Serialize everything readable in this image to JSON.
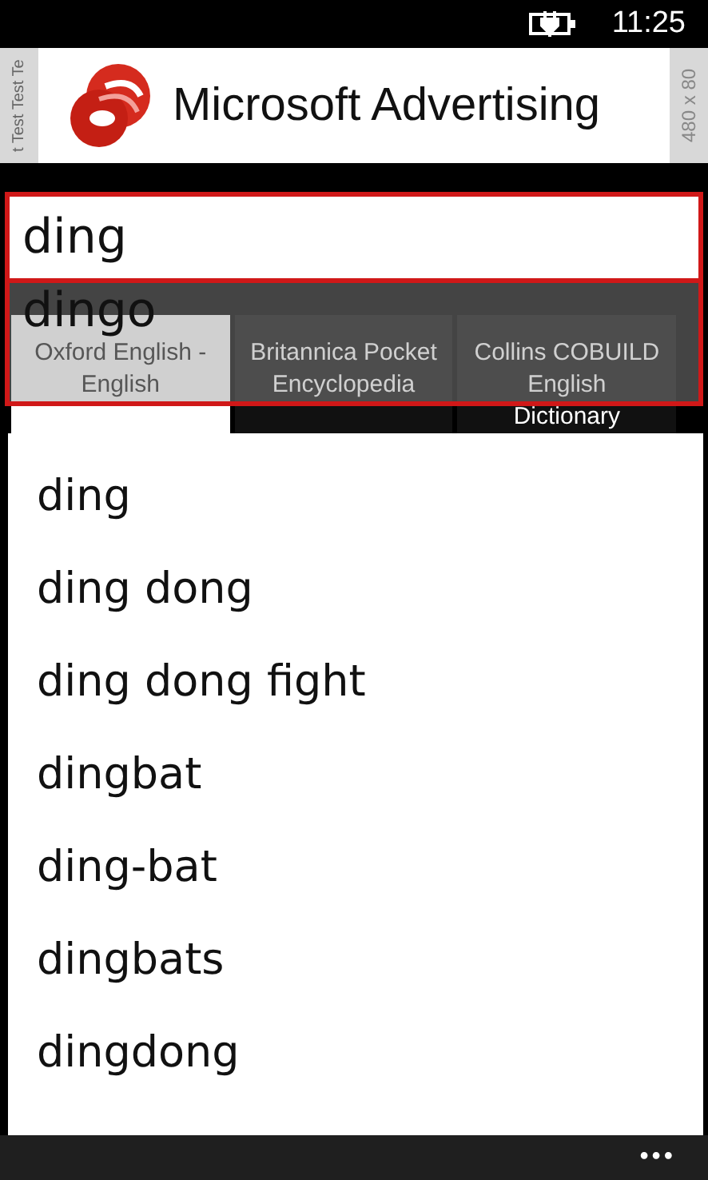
{
  "status_bar": {
    "time": "11:25"
  },
  "ad_banner": {
    "side_text": "t Test Test Te",
    "brand": "Microsoft Advertising",
    "size_label": "480 x 80"
  },
  "search": {
    "value": "ding"
  },
  "suggestions": [
    "dingo"
  ],
  "tabs": [
    {
      "label": "Oxford English -\nEnglish",
      "selected": true
    },
    {
      "label": "Britannica Pocket\nEncyclopedia",
      "selected": false
    },
    {
      "label": "Collins COBUILD\nEnglish\nDictionary",
      "selected": false
    }
  ],
  "results": [
    "ding",
    "ding dong",
    "ding dong fight",
    "dingbat",
    "ding-bat",
    "dingbats",
    "dingdong"
  ],
  "app_bar": {
    "more": "•••"
  }
}
